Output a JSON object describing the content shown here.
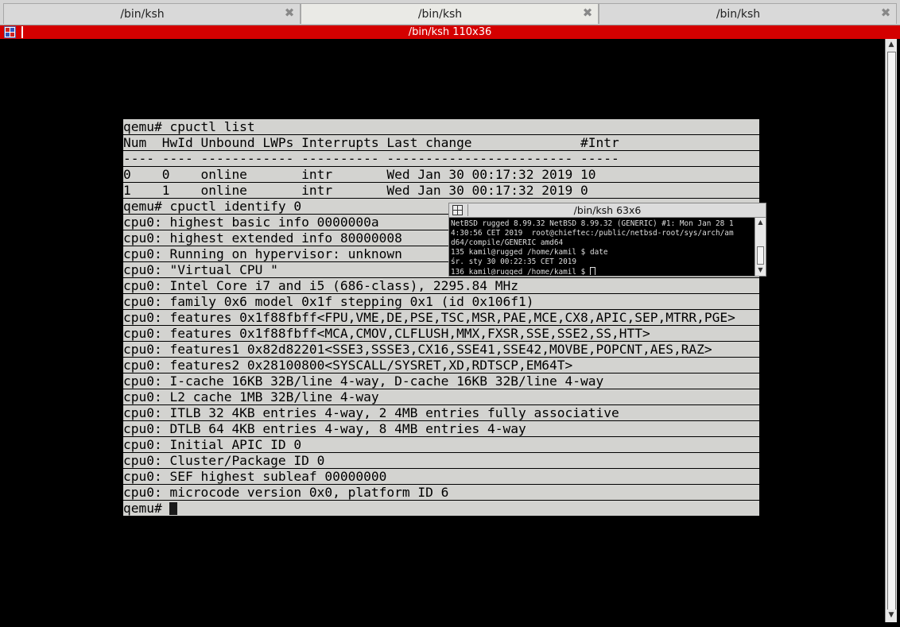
{
  "tabs": [
    {
      "label": "/bin/ksh",
      "active": false
    },
    {
      "label": "/bin/ksh",
      "active": true
    },
    {
      "label": "/bin/ksh",
      "active": false
    }
  ],
  "window": {
    "title": "/bin/ksh 110x36",
    "title_color": "#d40000"
  },
  "qemu": {
    "background": "#d3d3d0",
    "lines": [
      "qemu# cpuctl list",
      "Num  HwId Unbound LWPs Interrupts Last change              #Intr",
      "---- ---- ------------ ---------- ------------------------ -----",
      "0    0    online       intr       Wed Jan 30 00:17:32 2019 10",
      "1    1    online       intr       Wed Jan 30 00:17:32 2019 0",
      "qemu# cpuctl identify 0",
      "cpu0: highest basic info 0000000a",
      "cpu0: highest extended info 80000008",
      "cpu0: Running on hypervisor: unknown",
      "cpu0: \"Virtual CPU \"",
      "cpu0: Intel Core i7 and i5 (686-class), 2295.84 MHz",
      "cpu0: family 0x6 model 0x1f stepping 0x1 (id 0x106f1)",
      "cpu0: features 0x1f88fbff<FPU,VME,DE,PSE,TSC,MSR,PAE,MCE,CX8,APIC,SEP,MTRR,PGE>",
      "cpu0: features 0x1f88fbff<MCA,CMOV,CLFLUSH,MMX,FXSR,SSE,SSE2,SS,HTT>",
      "cpu0: features1 0x82d82201<SSE3,SSSE3,CX16,SSE41,SSE42,MOVBE,POPCNT,AES,RAZ>",
      "cpu0: features2 0x28100800<SYSCALL/SYSRET,XD,RDTSCP,EM64T>",
      "cpu0: I-cache 16KB 32B/line 4-way, D-cache 16KB 32B/line 4-way",
      "cpu0: L2 cache 1MB 32B/line 4-way",
      "cpu0: ITLB 32 4KB entries 4-way, 2 4MB entries fully associative",
      "cpu0: DTLB 64 4KB entries 4-way, 8 4MB entries 4-way",
      "cpu0: Initial APIC ID 0",
      "cpu0: Cluster/Package ID 0",
      "cpu0: SEF highest subleaf 00000000",
      "cpu0: microcode version 0x0, platform ID 6"
    ],
    "prompt": "qemu# "
  },
  "mini_terminal": {
    "title": "/bin/ksh 63x6",
    "lines": [
      "NetBSD rugged 8.99.32 NetBSD 8.99.32 (GENERIC) #1: Mon Jan 28 1",
      "4:30:56 CET 2019  root@chieftec:/public/netbsd-root/sys/arch/am",
      "d64/compile/GENERIC amd64",
      "135 kamil@rugged /home/kamil $ date",
      "śr. sty 30 00:22:35 CET 2019"
    ],
    "prompt": "136 kamil@rugged /home/kamil $ "
  },
  "icons": {
    "close": "✖",
    "arrow_up": "▲",
    "arrow_down": "▼"
  }
}
